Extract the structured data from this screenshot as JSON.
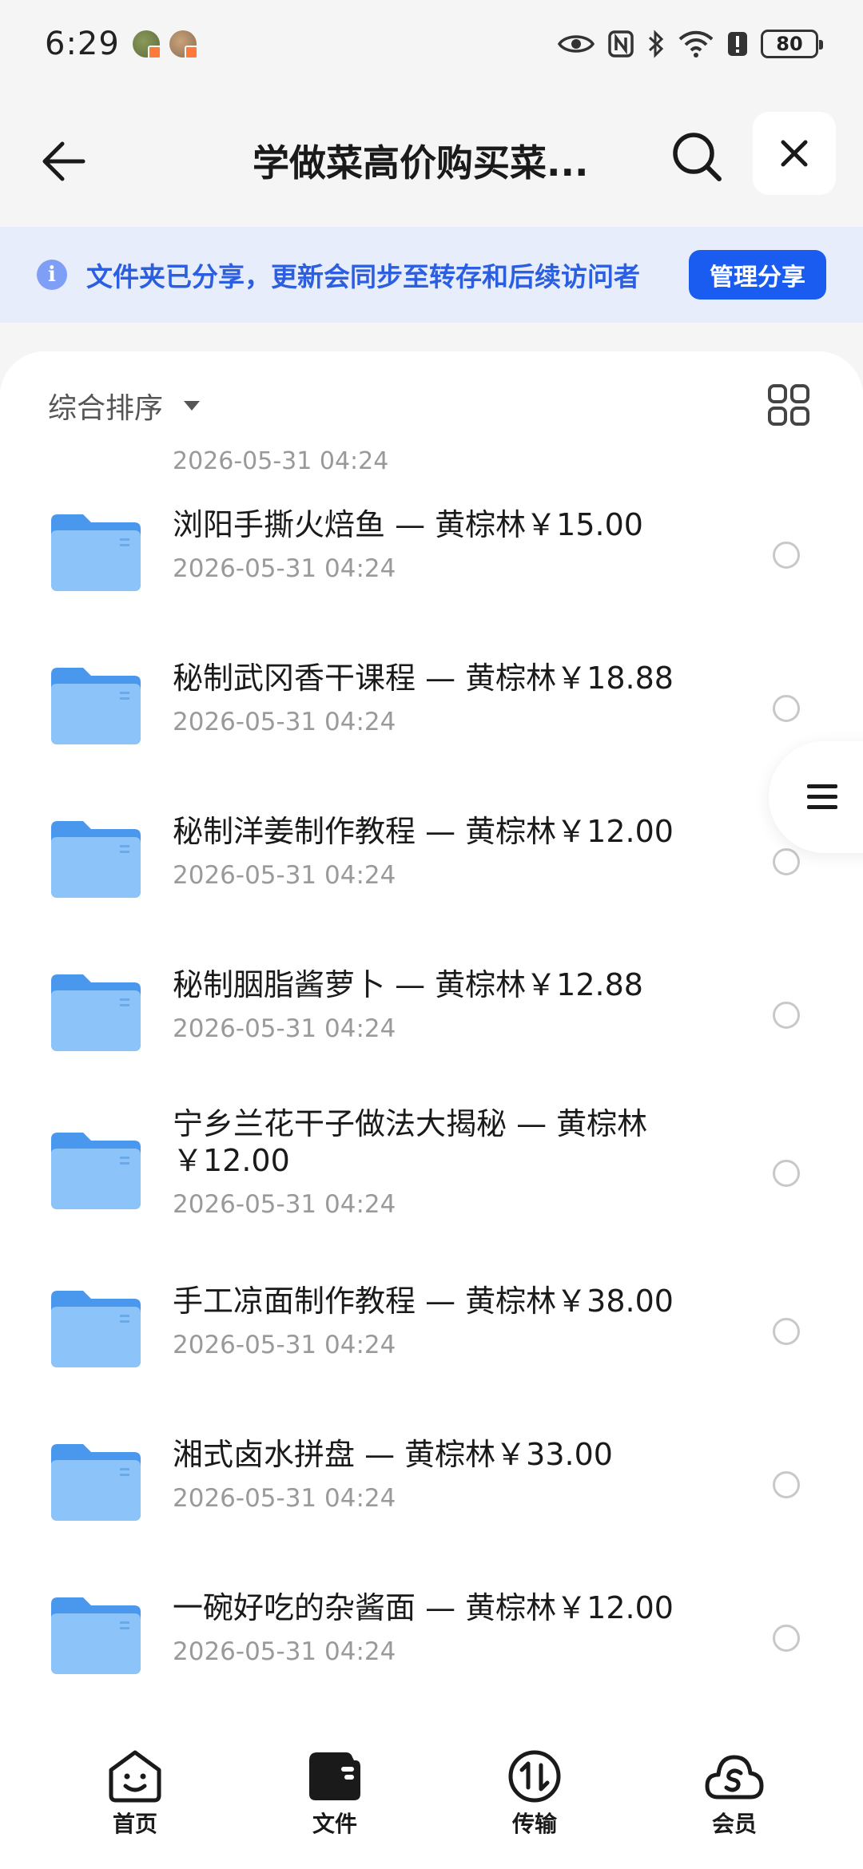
{
  "status_bar": {
    "time": "6:29",
    "battery": "80"
  },
  "header": {
    "title": "学做菜高价购买菜...",
    "back_icon": "arrow-left-icon",
    "search_icon": "search-icon",
    "close_icon": "close-icon"
  },
  "banner": {
    "text": "文件夹已分享，更新会同步至转存和后续访问者",
    "button": "管理分享",
    "info_glyph": "i"
  },
  "sort": {
    "label": "综合排序"
  },
  "list": {
    "partial_date": "2026-05-31 04:24",
    "items": [
      {
        "name": "浏阳手撕火焙鱼 — 黄棕林￥15.00",
        "date": "2026-05-31 04:24"
      },
      {
        "name": "秘制武冈香干课程 — 黄棕林￥18.88",
        "date": "2026-05-31 04:24"
      },
      {
        "name": "秘制洋姜制作教程 — 黄棕林￥12.00",
        "date": "2026-05-31 04:24"
      },
      {
        "name": "秘制胭脂酱萝卜 — 黄棕林￥12.88",
        "date": "2026-05-31 04:24"
      },
      {
        "name": "宁乡兰花干子做法大揭秘 — 黄棕林￥12.00",
        "date": "2026-05-31 04:24"
      },
      {
        "name": "手工凉面制作教程 — 黄棕林￥38.00",
        "date": "2026-05-31 04:24"
      },
      {
        "name": "湘式卤水拼盘 — 黄棕林￥33.00",
        "date": "2026-05-31 04:24"
      },
      {
        "name": "一碗好吃的杂酱面 — 黄棕林￥12.00",
        "date": "2026-05-31 04:24"
      }
    ]
  },
  "nav": {
    "items": [
      {
        "label": "首页",
        "icon": "home-icon"
      },
      {
        "label": "文件",
        "icon": "files-icon"
      },
      {
        "label": "传输",
        "icon": "transfer-icon"
      },
      {
        "label": "会员",
        "icon": "vip-icon"
      }
    ]
  },
  "colors": {
    "accent": "#1a5cf0",
    "banner_bg": "#e8edfb",
    "banner_text": "#2b5fe0",
    "folder": "#64aaf0"
  }
}
